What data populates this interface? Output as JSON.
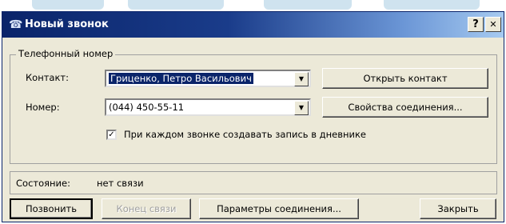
{
  "window": {
    "title": "Новый звонок",
    "help_button": "?",
    "close_button": "✕",
    "icon": "phone-icon"
  },
  "phone_group": {
    "legend": "Телефонный номер",
    "contact_label": "Контакт:",
    "contact_value": "Гриценко, Петро Васильович",
    "number_label": "Номер:",
    "number_value": "(044) 450-55-11",
    "open_contact_button": "Открыть контакт",
    "connection_properties_button": "Свойства соединения...",
    "journal_checkbox_label": "При каждом звонке создавать запись в дневнике",
    "journal_checked": true
  },
  "status": {
    "label": "Состояние:",
    "value": "нет связи"
  },
  "actions": {
    "call": "Позвонить",
    "end_call": "Конец связи",
    "connection_params": "Параметры соединения...",
    "close": "Закрыть"
  },
  "colors": {
    "titlebar_start": "#0a246a",
    "titlebar_end": "#a6caf0",
    "dialog_face": "#ece9d8",
    "selection": "#0a246a"
  }
}
